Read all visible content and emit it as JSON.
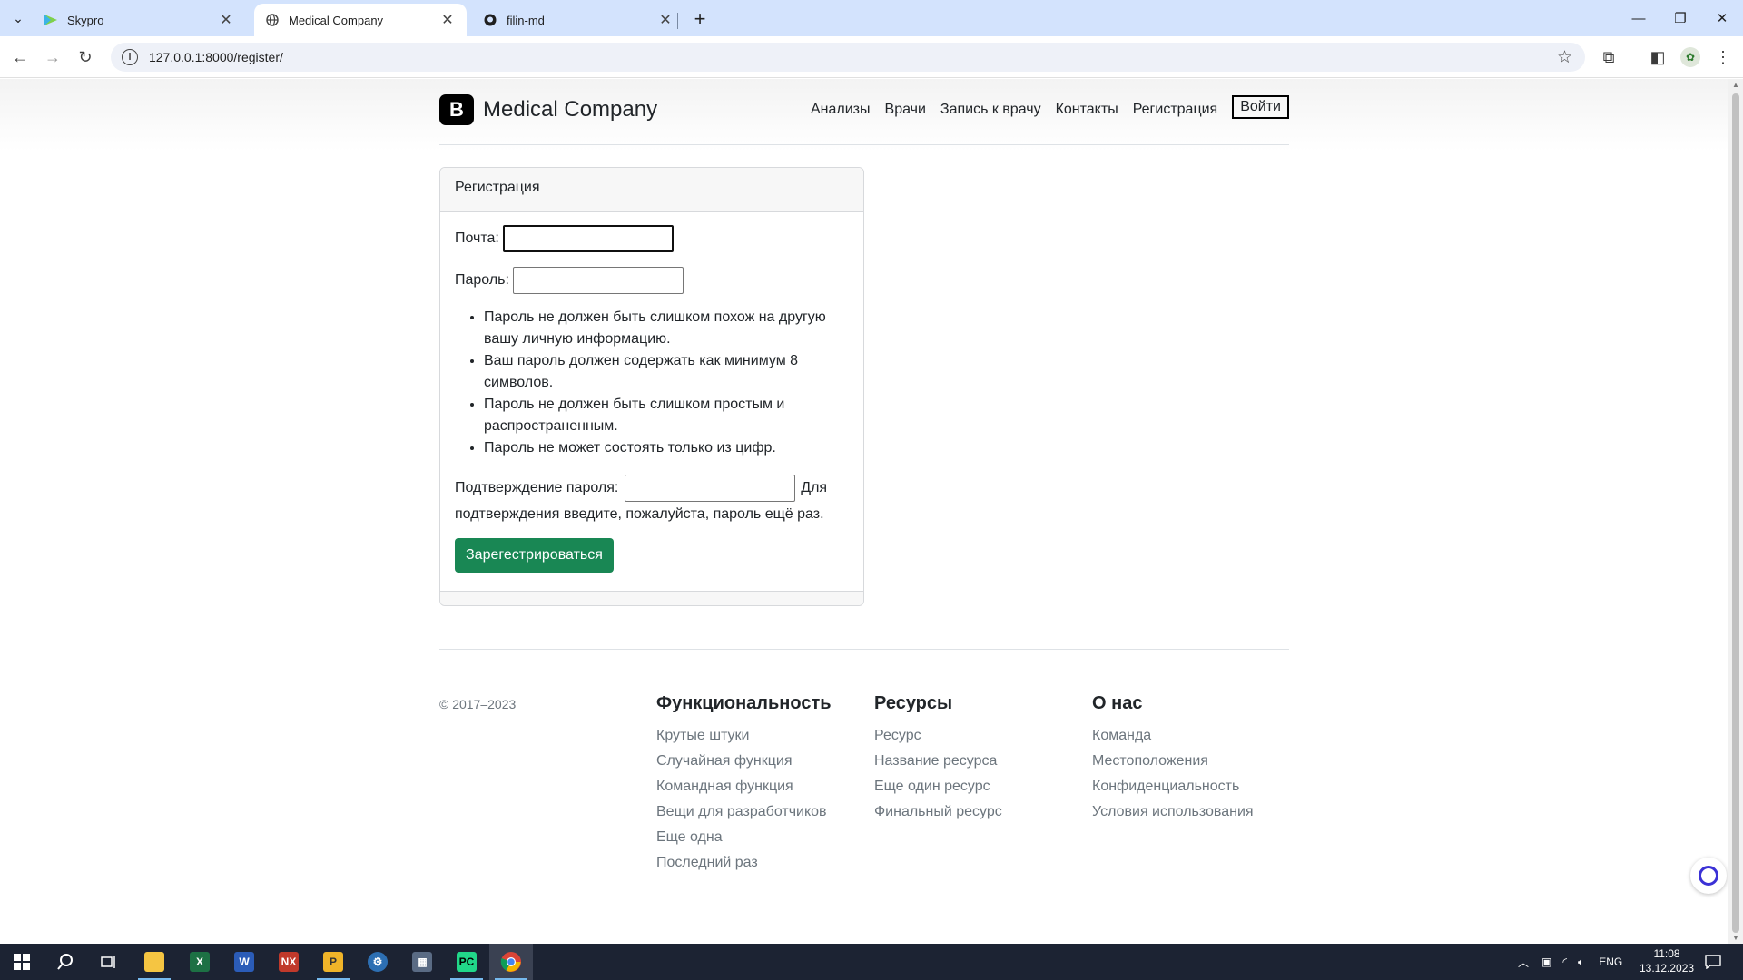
{
  "browser": {
    "tabs": [
      {
        "title": "Skypro",
        "icon": "skypro-icon"
      },
      {
        "title": "Medical Company",
        "icon": "globe-icon"
      },
      {
        "title": "filin-md",
        "icon": "github-icon"
      }
    ],
    "url": "127.0.0.1:8000/register/"
  },
  "site": {
    "brand_logo": "B",
    "brand_name": "Medical Company",
    "nav": [
      "Анализы",
      "Врачи",
      "Запись к врачу",
      "Контакты",
      "Регистрация"
    ],
    "login": "Войти"
  },
  "form": {
    "card_title": "Регистрация",
    "email_label": "Почта:",
    "email_value": "",
    "password_label": "Пароль:",
    "password_value": "",
    "help": [
      "Пароль не должен быть слишком похож на другую вашу личную информацию.",
      "Ваш пароль должен содержать как минимум 8 символов.",
      "Пароль не должен быть слишком простым и распространенным.",
      "Пароль не может состоять только из цифр."
    ],
    "confirm_label": "Подтверждение пароля:",
    "confirm_value": "",
    "confirm_help": "Для подтверждения введите, пожалуйста, пароль ещё раз.",
    "submit": "Зарегестрироваться",
    "submit_color": "#198754"
  },
  "footer": {
    "copyright": "© 2017–2023",
    "columns": [
      {
        "title": "Функциональность",
        "links": [
          "Крутые штуки",
          "Случайная функция",
          "Командная функция",
          "Вещи для разработчиков",
          "Еще одна",
          "Последний раз"
        ]
      },
      {
        "title": "Ресурсы",
        "links": [
          "Ресурс",
          "Название ресурса",
          "Еще один ресурс",
          "Финальный ресурс"
        ]
      },
      {
        "title": "О нас",
        "links": [
          "Команда",
          "Местоположения",
          "Конфиденциальность",
          "Условия использования"
        ]
      }
    ]
  },
  "taskbar": {
    "apps": [
      "file-explorer",
      "excel",
      "word",
      "nx",
      "powerpoint",
      "vpn",
      "calculator",
      "pycharm",
      "chrome"
    ],
    "language": "ENG",
    "time": "11:08",
    "date": "13.12.2023"
  }
}
